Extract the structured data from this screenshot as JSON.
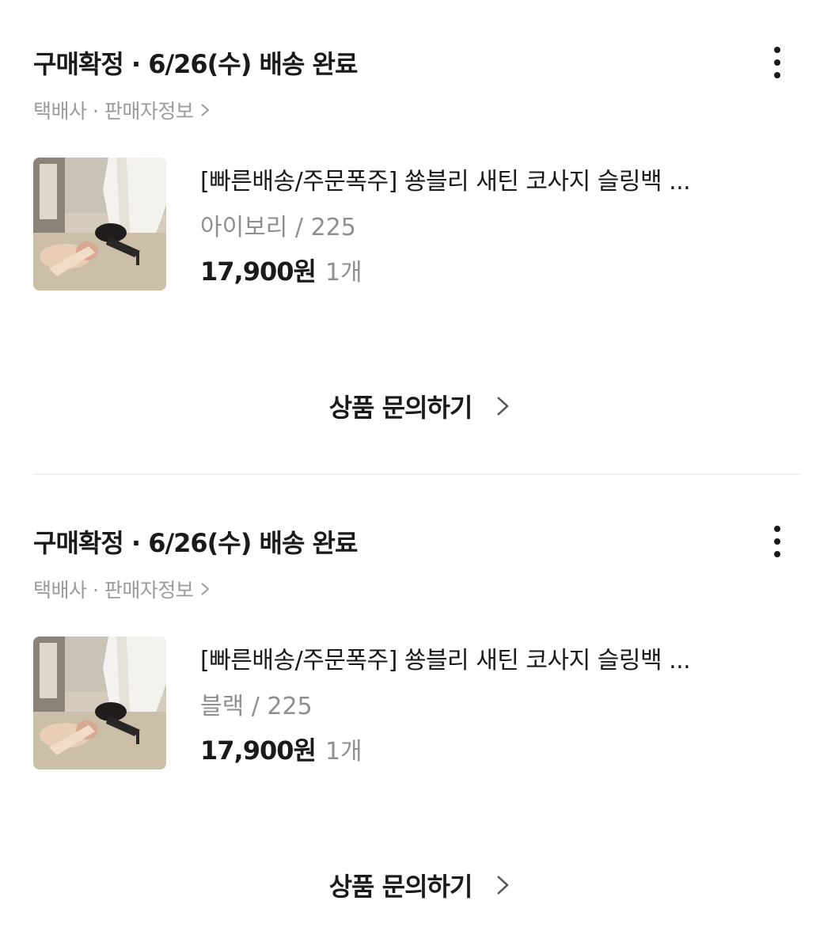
{
  "orders": [
    {
      "status_title": "구매확정 · 6/26(수) 배송 완료",
      "seller_link": "택배사 · 판매자정보",
      "product": {
        "name": "[빠른배송/주문폭주] 쑝블리 새틴 코사지 슬링백 ...",
        "option": "아이보리 / 225",
        "price": "17,900원",
        "quantity": "1개"
      },
      "inquiry_label": "상품 문의하기"
    },
    {
      "status_title": "구매확정 · 6/26(수) 배송 완료",
      "seller_link": "택배사 · 판매자정보",
      "product": {
        "name": "[빠른배송/주문폭주] 쑝블리 새틴 코사지 슬링백 ...",
        "option": "블랙 / 225",
        "price": "17,900원",
        "quantity": "1개"
      },
      "inquiry_label": "상품 문의하기"
    }
  ],
  "icons": {
    "more": "more-vertical-icon",
    "seller_chevron": "chevron-right-icon",
    "inquiry_chevron": "chevron-right-icon"
  },
  "colors": {
    "text_primary": "#1a1a1a",
    "text_secondary": "#9b9b9b",
    "divider": "#f0f0f0"
  }
}
